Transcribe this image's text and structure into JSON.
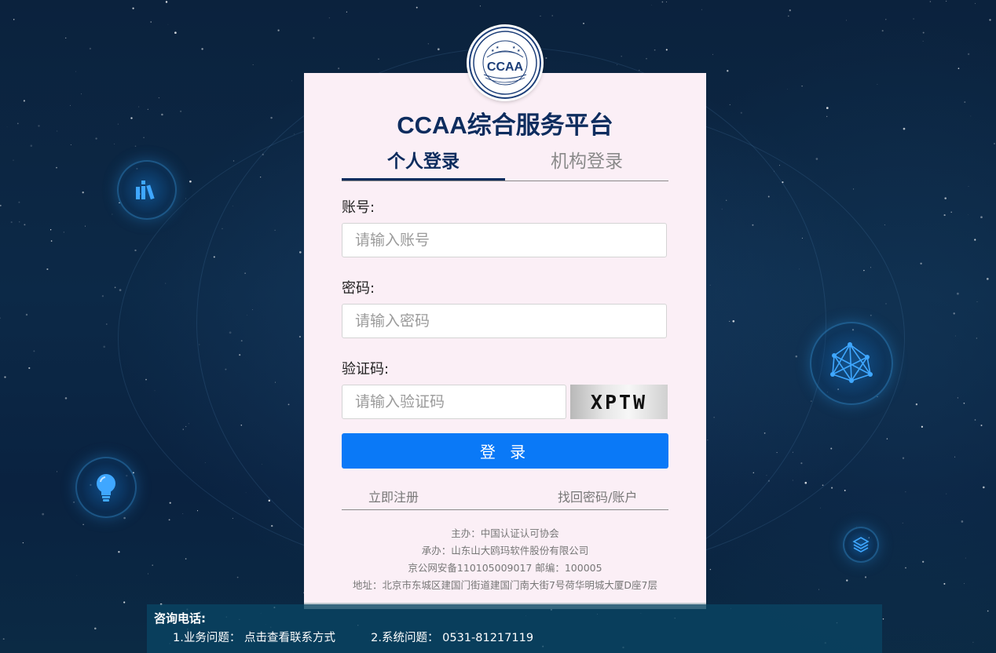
{
  "app": {
    "title": "CCAA综合服务平台"
  },
  "logo": {
    "text": "CCAA"
  },
  "tabs": [
    {
      "label": "个人登录",
      "active": true
    },
    {
      "label": "机构登录",
      "active": false
    }
  ],
  "form": {
    "account_label": "账号:",
    "account_placeholder": "请输入账号",
    "password_label": "密码:",
    "password_placeholder": "请输入密码",
    "captcha_label": "验证码:",
    "captcha_placeholder": "请输入验证码",
    "captcha_text": "XPTW",
    "login_label": "登 录"
  },
  "links": {
    "register": "立即注册",
    "recover": "找回密码/账户"
  },
  "info": {
    "host": "主办：中国认证认可协会",
    "organizer": "承办：山东山大鸥玛软件股份有限公司",
    "icp": "京公网安备110105009017 邮编：100005",
    "address": "地址：北京市东城区建国门街道建国门南大街7号荷华明城大厦D座7层"
  },
  "footer": {
    "title": "咨询电话:",
    "business_label": "1.业务问题：",
    "business_link": "点击查看联系方式",
    "system_label": "2.系统问题：",
    "system_phone": "0531-81217119"
  },
  "icons": [
    "books-icon",
    "network-icon",
    "lightbulb-icon",
    "layers-icon"
  ],
  "colors": {
    "accent": "#0a79f7",
    "title": "#0d2c5e",
    "card_bg": "#fbeff6",
    "background": "#0b223d"
  }
}
